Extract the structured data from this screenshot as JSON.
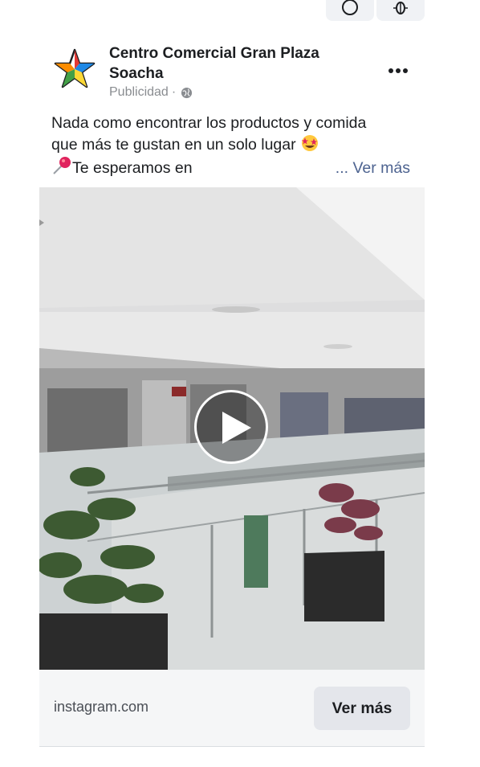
{
  "toolbar": {
    "buttons": [
      {
        "icon": "refresh-icon"
      },
      {
        "icon": "bug-icon"
      }
    ]
  },
  "post": {
    "page_name": "Centro Comercial Gran Plaza Soacha",
    "sponsored_label": "Publicidad",
    "separator": "·",
    "audience_icon": "globe-icon",
    "more_icon": "more-options-icon",
    "caption": {
      "line1": "Nada como encontrar los productos y comida",
      "line2": "que más te gustan en un solo lugar",
      "line2_emoji": "star-struck-emoji",
      "line3_emoji": "pushpin-emoji",
      "line3": "Te esperamos en",
      "see_more": "... Ver más"
    },
    "media": {
      "type": "video",
      "play_icon": "play-icon"
    },
    "link_preview": {
      "domain": "instagram.com",
      "cta_label": "Ver más"
    }
  },
  "colors": {
    "text": "#1c1e21",
    "secondary": "#8a8d91",
    "link": "#4d6390",
    "footer_bg": "#f5f6f7",
    "cta_bg": "#e4e6eb"
  }
}
